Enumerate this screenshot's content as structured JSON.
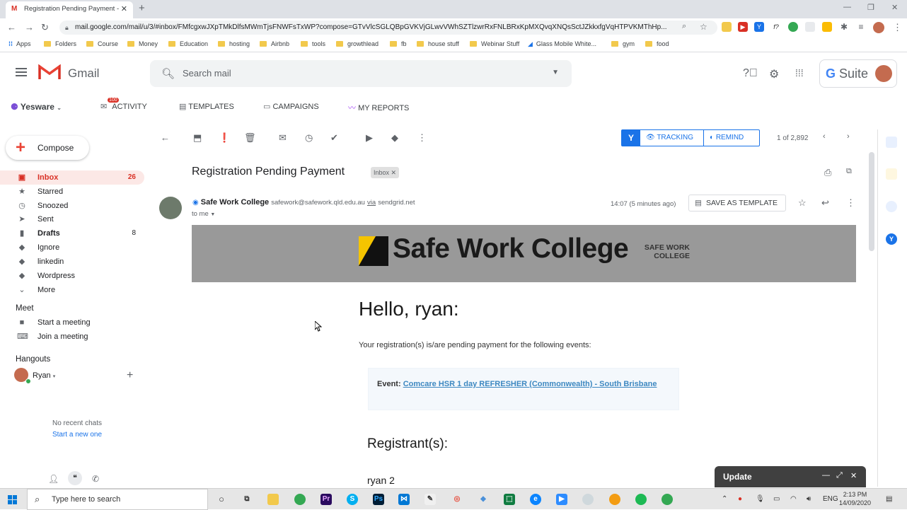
{
  "browser": {
    "tab_title": "Registration Pending Payment - ",
    "url": "mail.google.com/mail/u/3/#inbox/FMfcgxwJXpTMkDlfsMWmTjsFNWFsTxWP?compose=GTvVlcSGLQBpGVKVjGLwvVWhSZTlzwrRxFNLBRxKpMXQvqXNQsSctJZkkxfgVqHTPVKMThHp...",
    "bookmarks": [
      "Apps",
      "Folders",
      "Course",
      "Money",
      "Education",
      "hosting",
      "Airbnb",
      "tools",
      "growthlead",
      "fb",
      "house stuff",
      "Webinar Stuff",
      "Glass Mobile White...",
      "gym",
      "food"
    ]
  },
  "gmail": {
    "logo_text": "Gmail",
    "search_placeholder": "Search mail",
    "gsuite_label": "G Suite"
  },
  "yesware": {
    "brand": "Yesware",
    "activity_badge": "100",
    "activity": "ACTIVITY",
    "templates": "TEMPLATES",
    "campaigns": "CAMPAIGNS",
    "my_reports": "MY REPORTS"
  },
  "sidebar": {
    "compose": "Compose",
    "items": [
      {
        "label": "Inbox",
        "count": "26"
      },
      {
        "label": "Starred",
        "count": ""
      },
      {
        "label": "Snoozed",
        "count": ""
      },
      {
        "label": "Sent",
        "count": ""
      },
      {
        "label": "Drafts",
        "count": "8"
      },
      {
        "label": "Ignore",
        "count": ""
      },
      {
        "label": "linkedin",
        "count": ""
      },
      {
        "label": "Wordpress",
        "count": ""
      },
      {
        "label": "More",
        "count": ""
      }
    ],
    "meet": {
      "heading": "Meet",
      "start": "Start a meeting",
      "join": "Join a meeting"
    },
    "hangouts": {
      "heading": "Hangouts",
      "user": "Ryan",
      "no_chats": "No recent chats",
      "start_new": "Start a new one"
    }
  },
  "toolbar": {
    "tracking": "TRACKING",
    "remind": "REMIND",
    "pager": "1 of 2,892"
  },
  "email": {
    "subject": "Registration Pending Payment",
    "label": "Inbox",
    "sender_name": "Safe Work College",
    "sender_email": "safework@safework.qld.edu.au",
    "via": "via",
    "via_domain": "sendgrid.net",
    "to": "to me",
    "time": "14:07 (5 minutes ago)",
    "save_as_template": "SAVE AS TEMPLATE",
    "banner_title": "Safe Work College",
    "banner_small_1": "SAFE WORK",
    "banner_small_2": "COLLEGE",
    "greeting": "Hello, ryan:",
    "pending_text": "Your registration(s) is/are pending payment for the following events:",
    "event_label": "Event:",
    "event_link": "Comcare HSR 1 day REFRESHER (Commonwealth) - South Brisbane",
    "registrant_heading": "Registrant(s):",
    "registrant_name": "ryan 2"
  },
  "update_popup": {
    "label": "Update"
  },
  "taskbar": {
    "search_placeholder": "Type here to search",
    "lang": "ENG",
    "time": "2:13 PM",
    "date": "14/09/2020"
  }
}
